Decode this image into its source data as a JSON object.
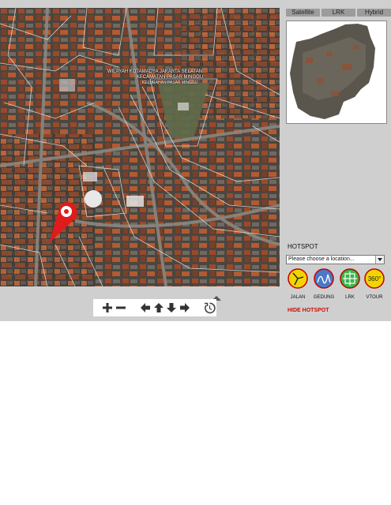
{
  "map": {
    "labels": [
      "WILAYAH KOTAMADYA JAKARTA SELATAN",
      "KECAMATAN PASAR MINGGU",
      "KELURAHAN PASAR MINGGU"
    ]
  },
  "toolbar": {
    "buttons": [
      "zoom-in-icon",
      "zoom-out-icon",
      "pan-left-icon",
      "pan-up-icon",
      "pan-down-icon",
      "pan-right-icon",
      "reset-icon"
    ]
  },
  "layers": {
    "tabs": [
      "Satellite",
      "LRK",
      "Hybrid"
    ]
  },
  "hotspot": {
    "title": "HOTSPOT",
    "placeholder": "Please choose a location...",
    "categories": [
      {
        "label": "JALAN",
        "color": "#f2d500"
      },
      {
        "label": "GEDUNG",
        "color": "#4a79c9"
      },
      {
        "label": "LRK",
        "color": "#39b54a"
      },
      {
        "label": "VTOUR",
        "color": "#f2d500",
        "text": "360°"
      }
    ],
    "hide_label": "HIDE HOTSPOT"
  },
  "colors": {
    "pin": "#e01b1b",
    "hide_link": "#cc1100",
    "panel_bg": "#cfcfcf"
  }
}
